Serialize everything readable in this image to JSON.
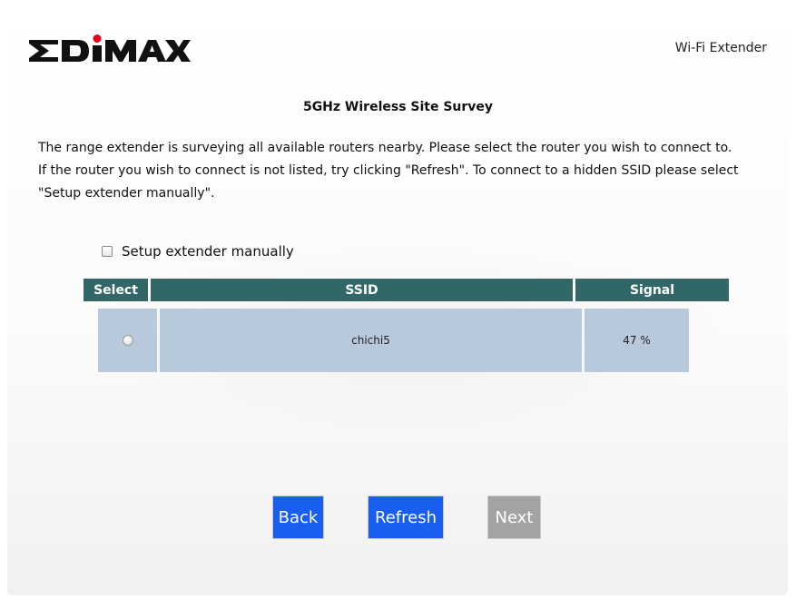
{
  "header": {
    "brand": "EDIMAX",
    "product": "Wi-Fi Extender"
  },
  "page": {
    "title": "5GHz Wireless Site Survey",
    "description_lines": [
      "The range extender is surveying all available routers nearby. Please select the router you wish to connect to.",
      "If the router you wish to connect is not listed, try clicking \"Refresh\". To connect to a hidden SSID please select",
      "\"Setup extender manually\"."
    ]
  },
  "manual_setup": {
    "label": "Setup extender manually",
    "checked": false
  },
  "table": {
    "headers": [
      "Select",
      "SSID",
      "Signal"
    ],
    "rows": [
      {
        "selected": false,
        "ssid": "chichi5",
        "signal": "47 %"
      }
    ]
  },
  "buttons": {
    "back": "Back",
    "refresh": "Refresh",
    "next": "Next"
  },
  "colors": {
    "header_bg": "#326768",
    "row_bg": "#b8c9dc",
    "button_active": "#1a5ef0",
    "button_disabled": "#a3a3a3",
    "logo_dot": "#e8001c"
  }
}
